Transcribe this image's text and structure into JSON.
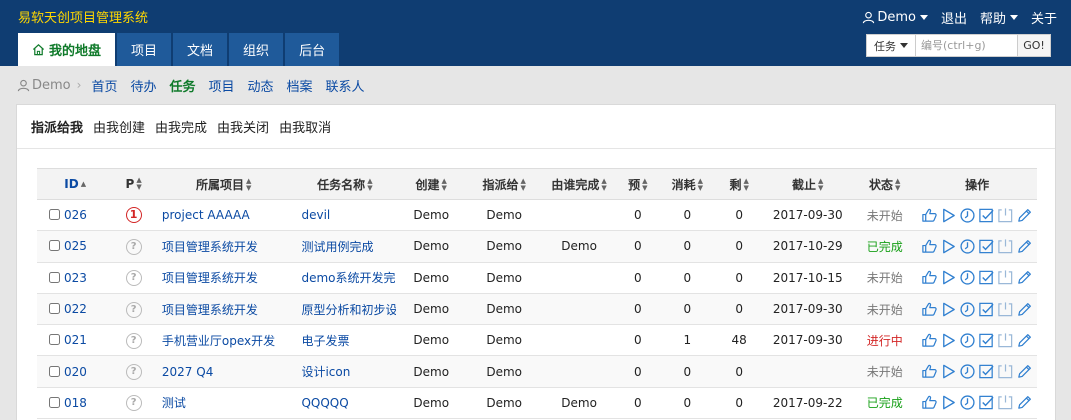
{
  "header": {
    "app_title": "易软天创项目管理系统",
    "user": "Demo",
    "logout": "退出",
    "help": "帮助",
    "about": "关于"
  },
  "tabs": [
    {
      "label": "我的地盘"
    },
    {
      "label": "项目"
    },
    {
      "label": "文档"
    },
    {
      "label": "组织"
    },
    {
      "label": "后台"
    }
  ],
  "search": {
    "type": "任务",
    "placeholder": "编号(ctrl+g)",
    "go": "GO!"
  },
  "subnav": {
    "user": "Demo",
    "items": [
      {
        "label": "首页"
      },
      {
        "label": "待办"
      },
      {
        "label": "任务"
      },
      {
        "label": "项目"
      },
      {
        "label": "动态"
      },
      {
        "label": "档案"
      },
      {
        "label": "联系人"
      }
    ]
  },
  "filters": [
    {
      "label": "指派给我"
    },
    {
      "label": "由我创建"
    },
    {
      "label": "由我完成"
    },
    {
      "label": "由我关闭"
    },
    {
      "label": "由我取消"
    }
  ],
  "table": {
    "columns": [
      "ID",
      "P",
      "所属项目",
      "任务名称",
      "创建",
      "指派给",
      "由谁完成",
      "预",
      "消耗",
      "剩",
      "截止",
      "状态",
      "操作"
    ],
    "rows": [
      {
        "id": "026",
        "pri": "1",
        "project": "project AAAAA",
        "name": "devil",
        "creator": "Demo",
        "assigned": "Demo",
        "finished_by": "",
        "est": "0",
        "consumed": "0",
        "left": "0",
        "deadline": "2017-09-30",
        "status": "未开始",
        "status_type": "wait"
      },
      {
        "id": "025",
        "pri": "?",
        "project": "项目管理系统开发",
        "name": "测试用例完成",
        "creator": "Demo",
        "assigned": "Demo",
        "finished_by": "Demo",
        "est": "0",
        "consumed": "0",
        "left": "0",
        "deadline": "2017-10-29",
        "status": "已完成",
        "status_type": "done"
      },
      {
        "id": "023",
        "pri": "?",
        "project": "项目管理系统开发",
        "name": "demo系统开发完成",
        "creator": "Demo",
        "assigned": "Demo",
        "finished_by": "",
        "est": "0",
        "consumed": "0",
        "left": "0",
        "deadline": "2017-10-15",
        "status": "未开始",
        "status_type": "wait"
      },
      {
        "id": "022",
        "pri": "?",
        "project": "项目管理系统开发",
        "name": "原型分析和初步设计",
        "creator": "Demo",
        "assigned": "Demo",
        "finished_by": "",
        "est": "0",
        "consumed": "0",
        "left": "0",
        "deadline": "2017-09-30",
        "status": "未开始",
        "status_type": "wait"
      },
      {
        "id": "021",
        "pri": "?",
        "project": "手机营业厅opex开发",
        "name": "电子发票",
        "creator": "Demo",
        "assigned": "Demo",
        "finished_by": "",
        "est": "0",
        "consumed": "1",
        "left": "48",
        "deadline": "2017-09-30",
        "status": "进行中",
        "status_type": "doing"
      },
      {
        "id": "020",
        "pri": "?",
        "project": "2027 Q4",
        "name": "设计icon",
        "creator": "Demo",
        "assigned": "Demo",
        "finished_by": "",
        "est": "0",
        "consumed": "0",
        "left": "0",
        "deadline": "",
        "status": "未开始",
        "status_type": "wait"
      },
      {
        "id": "018",
        "pri": "?",
        "project": "测试",
        "name": "QQQQQ",
        "creator": "Demo",
        "assigned": "Demo",
        "finished_by": "Demo",
        "est": "0",
        "consumed": "0",
        "left": "0",
        "deadline": "2017-09-22",
        "status": "已完成",
        "status_type": "done"
      }
    ]
  },
  "colors": {
    "header_bg": "#0f3d72",
    "title": "#ffd700",
    "link": "#0b4aa3",
    "active_green": "#0f7a2a",
    "done": "#18a018",
    "doing": "#d32626",
    "icon_blue": "#2f7fd0"
  },
  "icons": {
    "user": "user-icon",
    "home": "home-icon",
    "ops": [
      "assign-icon",
      "start-icon",
      "record-time-icon",
      "finish-icon",
      "close-icon",
      "edit-icon"
    ]
  }
}
